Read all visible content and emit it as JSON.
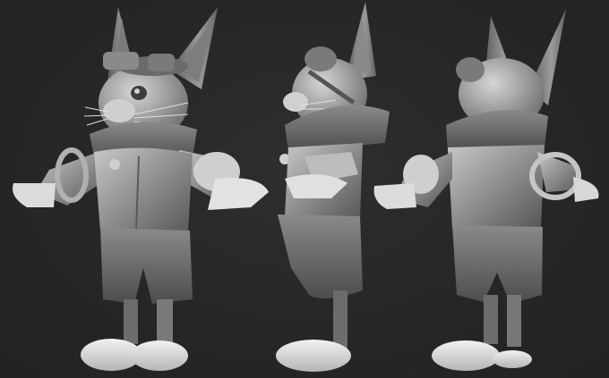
{
  "scene": {
    "background_color": "#262626",
    "clay_color": "#9a9a9a",
    "highlight_color": "#d9d9d9",
    "shadow_color": "#4a4a4a",
    "views": [
      {
        "name": "three-quarter-front-view"
      },
      {
        "name": "side-view"
      },
      {
        "name": "three-quarter-back-view"
      }
    ]
  }
}
